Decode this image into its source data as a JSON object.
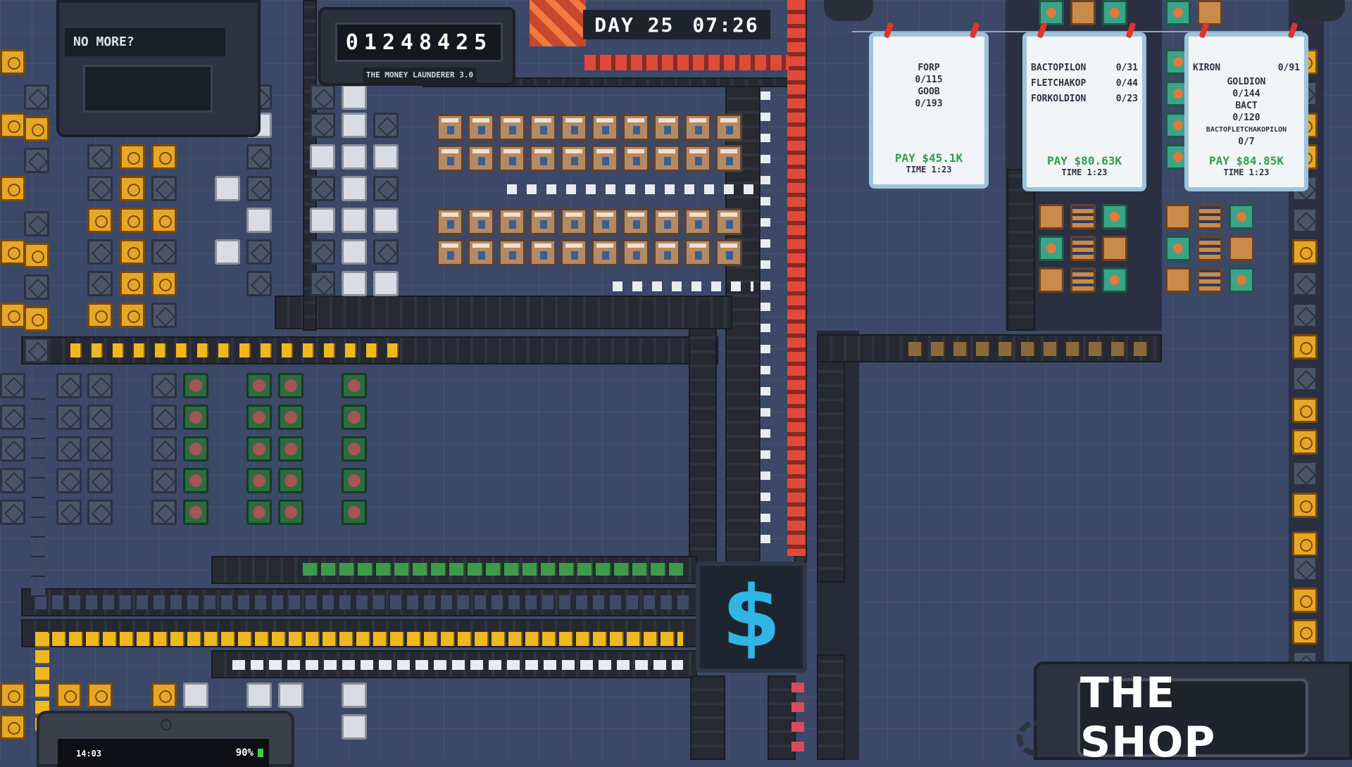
{
  "hud": {
    "money_counter": "01248425",
    "launderer_label": "THE MONEY LAUNDERER 3.0",
    "day": "DAY 25",
    "clock": "07:26",
    "no_more_label": "NO MORE?"
  },
  "orders": [
    {
      "items": [
        {
          "name": "FORP",
          "progress": "0/115"
        },
        {
          "name": "GOOB",
          "progress": "0/193"
        }
      ],
      "pay": "PAY $45.1K",
      "time": "TIME 1:23"
    },
    {
      "items": [
        {
          "name": "BACTOPILON",
          "progress": "0/31"
        },
        {
          "name": "FLETCHAKOP",
          "progress": "0/44"
        },
        {
          "name": "FORKOLDION",
          "progress": "0/23"
        }
      ],
      "pay": "PAY $80.63K",
      "time": "TIME 1:23"
    },
    {
      "items": [
        {
          "name": "KIRON",
          "progress": "0/91"
        },
        {
          "name": "GOLDION",
          "progress": "0/144"
        },
        {
          "name": "BACT",
          "progress": "0/120"
        },
        {
          "name": "BACTOFLETCHAKOPILON",
          "progress": "0/7"
        }
      ],
      "pay": "PAY $84.85K",
      "time": "TIME 1:23"
    }
  ],
  "shop": {
    "label": "THE SHOP"
  },
  "sell_point": {
    "symbol": "$"
  },
  "phone": {
    "time": "14:03",
    "battery": "90%"
  },
  "colors": {
    "background": "#3b4867",
    "belt": "#262932",
    "pay_green": "#2e9e4a",
    "dollar_blue": "#2fb6e4",
    "gold": "#e6a726"
  }
}
